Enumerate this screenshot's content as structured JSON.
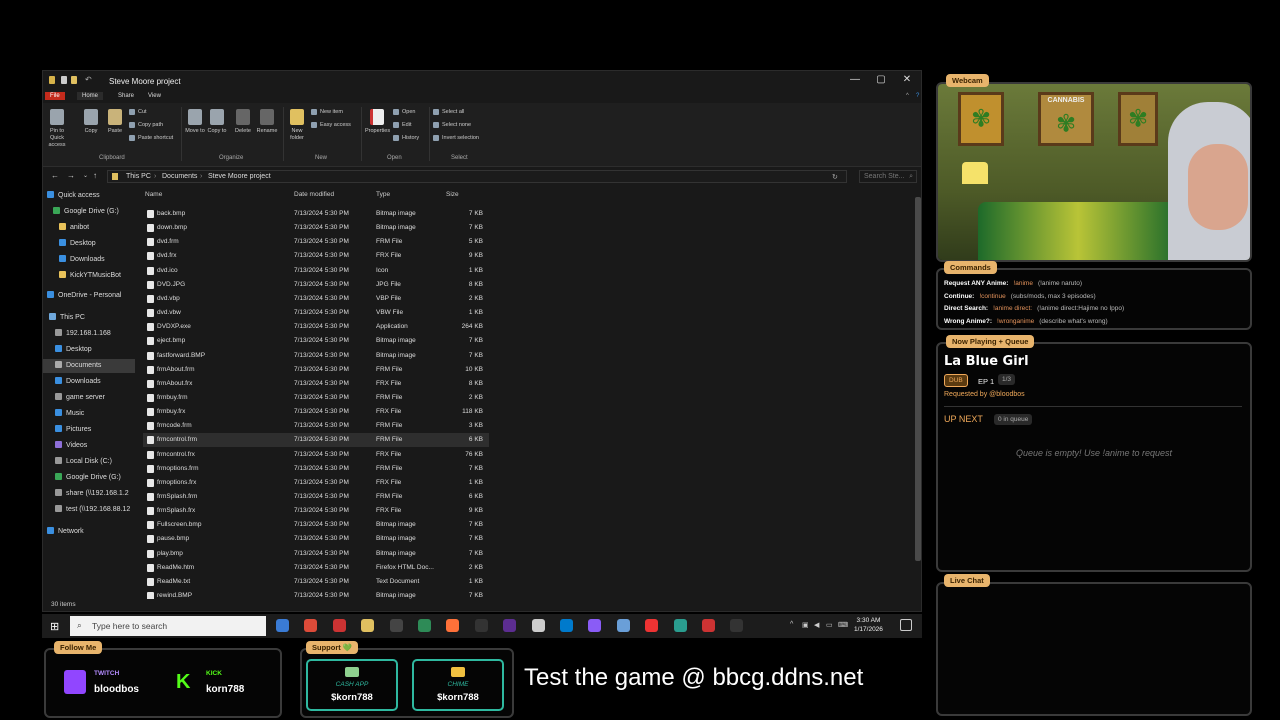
{
  "explorer": {
    "title": "Steve Moore project",
    "window_controls": [
      "—",
      "▢",
      "✕"
    ],
    "tabs": [
      "File",
      "Home",
      "Share",
      "View"
    ],
    "ribbon": {
      "pin": "Pin to Quick access",
      "copy": "Copy",
      "paste": "Paste",
      "cut": "Cut",
      "copy_path": "Copy path",
      "paste_shortcut": "Paste shortcut",
      "move_to": "Move to",
      "copy_to": "Copy to",
      "delete": "Delete",
      "rename": "Rename",
      "new_folder": "New folder",
      "new_item": "New item",
      "easy_access": "Easy access",
      "properties": "Properties",
      "open": "Open",
      "edit": "Edit",
      "history": "History",
      "select_all": "Select all",
      "select_none": "Select none",
      "invert_selection": "Invert selection",
      "groups": [
        "Clipboard",
        "Organize",
        "New",
        "Open",
        "Select"
      ]
    },
    "breadcrumb": [
      "This PC",
      "Documents",
      "Steve Moore project"
    ],
    "search_placeholder": "Search Ste...",
    "columns": [
      "Name",
      "Date modified",
      "Type",
      "Size"
    ],
    "nav": [
      {
        "label": "Quick access",
        "color": "#3a8fe0"
      },
      {
        "label": "Google Drive (G:)",
        "color": "#3aa757"
      },
      {
        "label": "anibot",
        "color": "#e8c25a"
      },
      {
        "label": "Desktop",
        "color": "#3a8fe0"
      },
      {
        "label": "Downloads",
        "color": "#3a8fe0"
      },
      {
        "label": "KickYTMusicBot",
        "color": "#e8c25a"
      },
      {
        "label": "OneDrive - Personal",
        "color": "#3a8fe0"
      },
      {
        "label": "This PC",
        "color": "#6fa8dc"
      },
      {
        "label": "192.168.1.168",
        "color": "#999"
      },
      {
        "label": "Desktop",
        "color": "#3a8fe0"
      },
      {
        "label": "Documents",
        "color": "#aaa"
      },
      {
        "label": "Downloads",
        "color": "#3a8fe0"
      },
      {
        "label": "game server",
        "color": "#999"
      },
      {
        "label": "Music",
        "color": "#3a8fe0"
      },
      {
        "label": "Pictures",
        "color": "#3a8fe0"
      },
      {
        "label": "Videos",
        "color": "#8e6fd8"
      },
      {
        "label": "Local Disk (C:)",
        "color": "#999"
      },
      {
        "label": "Google Drive (G:)",
        "color": "#3aa757"
      },
      {
        "label": "share (\\\\192.168.1.2",
        "color": "#999"
      },
      {
        "label": "test (\\\\192.168.88.12",
        "color": "#999"
      },
      {
        "label": "Network",
        "color": "#3a8fe0"
      }
    ],
    "files": [
      {
        "name": "back.bmp",
        "date": "7/13/2024 5:30 PM",
        "type": "Bitmap image",
        "size": "7 KB"
      },
      {
        "name": "down.bmp",
        "date": "7/13/2024 5:30 PM",
        "type": "Bitmap image",
        "size": "7 KB"
      },
      {
        "name": "dvd.frm",
        "date": "7/13/2024 5:30 PM",
        "type": "FRM File",
        "size": "5 KB"
      },
      {
        "name": "dvd.frx",
        "date": "7/13/2024 5:30 PM",
        "type": "FRX File",
        "size": "9 KB"
      },
      {
        "name": "dvd.ico",
        "date": "7/13/2024 5:30 PM",
        "type": "Icon",
        "size": "1 KB"
      },
      {
        "name": "DVD.JPG",
        "date": "7/13/2024 5:30 PM",
        "type": "JPG File",
        "size": "8 KB"
      },
      {
        "name": "dvd.vbp",
        "date": "7/13/2024 5:30 PM",
        "type": "VBP File",
        "size": "2 KB"
      },
      {
        "name": "dvd.vbw",
        "date": "7/13/2024 5:30 PM",
        "type": "VBW File",
        "size": "1 KB"
      },
      {
        "name": "DVDXP.exe",
        "date": "7/13/2024 5:30 PM",
        "type": "Application",
        "size": "264 KB"
      },
      {
        "name": "eject.bmp",
        "date": "7/13/2024 5:30 PM",
        "type": "Bitmap image",
        "size": "7 KB"
      },
      {
        "name": "fastforward.BMP",
        "date": "7/13/2024 5:30 PM",
        "type": "Bitmap image",
        "size": "7 KB"
      },
      {
        "name": "frmAbout.frm",
        "date": "7/13/2024 5:30 PM",
        "type": "FRM File",
        "size": "10 KB"
      },
      {
        "name": "frmAbout.frx",
        "date": "7/13/2024 5:30 PM",
        "type": "FRX File",
        "size": "8 KB"
      },
      {
        "name": "frmbuy.frm",
        "date": "7/13/2024 5:30 PM",
        "type": "FRM File",
        "size": "2 KB"
      },
      {
        "name": "frmbuy.frx",
        "date": "7/13/2024 5:30 PM",
        "type": "FRX File",
        "size": "118 KB"
      },
      {
        "name": "frmcode.frm",
        "date": "7/13/2024 5:30 PM",
        "type": "FRM File",
        "size": "3 KB"
      },
      {
        "name": "frmcontrol.frm",
        "date": "7/13/2024 5:30 PM",
        "type": "FRM File",
        "size": "6 KB"
      },
      {
        "name": "frmcontrol.frx",
        "date": "7/13/2024 5:30 PM",
        "type": "FRX File",
        "size": "76 KB"
      },
      {
        "name": "frmoptions.frm",
        "date": "7/13/2024 5:30 PM",
        "type": "FRM File",
        "size": "7 KB"
      },
      {
        "name": "frmoptions.frx",
        "date": "7/13/2024 5:30 PM",
        "type": "FRX File",
        "size": "1 KB"
      },
      {
        "name": "frmSplash.frm",
        "date": "7/13/2024 5:30 PM",
        "type": "FRM File",
        "size": "6 KB"
      },
      {
        "name": "frmSplash.frx",
        "date": "7/13/2024 5:30 PM",
        "type": "FRX File",
        "size": "9 KB"
      },
      {
        "name": "Fullscreen.bmp",
        "date": "7/13/2024 5:30 PM",
        "type": "Bitmap image",
        "size": "7 KB"
      },
      {
        "name": "pause.bmp",
        "date": "7/13/2024 5:30 PM",
        "type": "Bitmap image",
        "size": "7 KB"
      },
      {
        "name": "play.bmp",
        "date": "7/13/2024 5:30 PM",
        "type": "Bitmap image",
        "size": "7 KB"
      },
      {
        "name": "ReadMe.htm",
        "date": "7/13/2024 5:30 PM",
        "type": "Firefox HTML Doc...",
        "size": "2 KB"
      },
      {
        "name": "ReadMe.txt",
        "date": "7/13/2024 5:30 PM",
        "type": "Text Document",
        "size": "1 KB"
      },
      {
        "name": "rewind.BMP",
        "date": "7/13/2024 5:30 PM",
        "type": "Bitmap image",
        "size": "7 KB"
      }
    ],
    "highlighted_file": "frmcontrol.frm",
    "status": "30 items"
  },
  "taskbar": {
    "search_placeholder": "Type here to search",
    "time": "3:30 AM",
    "date": "1/17/2026",
    "icons": [
      "edge-icon",
      "chrome-icon",
      "voice-icon",
      "folder-icon",
      "obs-icon",
      "app-icon",
      "firefox-icon",
      "terminal-icon",
      "visualstudio-icon",
      "notepad-icon",
      "vscode-icon",
      "gem-icon",
      "tool-icon",
      "record-icon",
      "vs-icon",
      "pdf-icon",
      "dvd-player-icon"
    ]
  },
  "overlay": {
    "webcam_tag": "Webcam",
    "poster_text": "CANNABIS",
    "commands_tag": "Commands",
    "commands": [
      {
        "label": "Request ANY Anime:",
        "cmd": "!anime",
        "desc": "(!anime naruto)"
      },
      {
        "label": "Continue:",
        "cmd": "!continue",
        "desc": "(subs/mods, max 3 episodes)"
      },
      {
        "label": "Direct Search:",
        "cmd": "!anime direct:",
        "desc": "(!anime direct:Hajime no Ippo)"
      },
      {
        "label": "Wrong Anime?:",
        "cmd": "!wronganime",
        "desc": "(describe what's wrong)"
      }
    ],
    "now_playing_tag": "Now Playing + Queue",
    "now_playing_title": "La Blue Girl",
    "dub_badge": "DUB",
    "episode": "EP 1",
    "episode_count": "1/3",
    "requested_by": "Requested by @bloodbos",
    "up_next": "UP NEXT",
    "queue_count": "0 in queue",
    "queue_empty": "Queue is empty! Use !anime to request",
    "live_chat_tag": "Live Chat",
    "follow_tag": "Follow Me",
    "twitch_label": "TWITCH",
    "twitch_user": "bloodbos",
    "kick_label": "KICK",
    "kick_user": "korn788",
    "support_tag": "Support 💚",
    "cashapp_label": "CASH APP",
    "cashapp_user": "$korn788",
    "chime_label": "CHIME",
    "chime_user": "$korn788",
    "promo": "Test the game @ bbcg.ddns.net"
  },
  "colors": {
    "accent": "#e8b46c",
    "teal": "#2fb9a0",
    "twitch": "#9146ff",
    "kick": "#53fc18"
  }
}
